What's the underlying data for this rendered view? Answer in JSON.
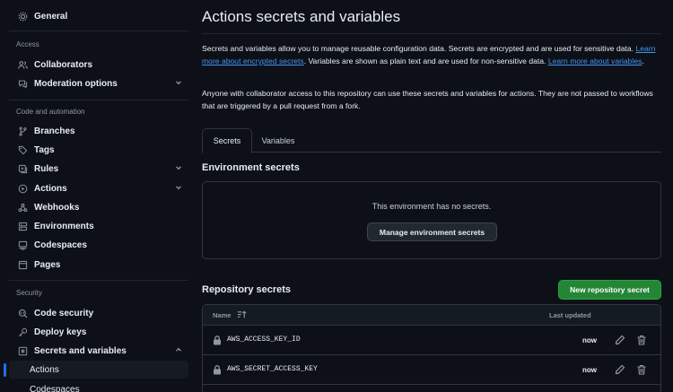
{
  "sidebar": {
    "general": "General",
    "sections": {
      "access": "Access",
      "code_automation": "Code and automation",
      "security": "Security"
    },
    "items": {
      "collaborators": "Collaborators",
      "moderation": "Moderation options",
      "branches": "Branches",
      "tags": "Tags",
      "rules": "Rules",
      "actions": "Actions",
      "webhooks": "Webhooks",
      "environments": "Environments",
      "codespaces": "Codespaces",
      "pages": "Pages",
      "code_security": "Code security",
      "deploy_keys": "Deploy keys",
      "secrets_variables": "Secrets and variables",
      "sub_actions": "Actions",
      "sub_codespaces": "Codespaces"
    }
  },
  "main": {
    "title": "Actions secrets and variables",
    "intro": {
      "p1_a": "Secrets and variables allow you to manage reusable configuration data. Secrets are encrypted and are used for sensitive data. ",
      "link1": "Learn more about encrypted secrets",
      "p1_b": ". Variables are shown as plain text and are used for non-sensitive data. ",
      "link2": "Learn more about variables",
      "p1_c": ".",
      "p2": "Anyone with collaborator access to this repository can use these secrets and variables for actions. They are not passed to workflows that are triggered by a pull request from a fork."
    },
    "tabs": {
      "secrets": "Secrets",
      "variables": "Variables"
    },
    "environment": {
      "heading": "Environment secrets",
      "empty": "This environment has no secrets.",
      "manage_button": "Manage environment secrets"
    },
    "repository": {
      "heading": "Repository secrets",
      "new_button": "New repository secret",
      "col_name": "Name",
      "col_updated": "Last updated",
      "rows": [
        {
          "name": "AWS_ACCESS_KEY_ID",
          "updated": "now"
        },
        {
          "name": "AWS_SECRET_ACCESS_KEY",
          "updated": "now"
        }
      ]
    }
  },
  "colors": {
    "background": "#0d1117",
    "border": "#30363d",
    "link": "#4493f8",
    "primary_button": "#238636",
    "active_indicator": "#1f6feb"
  }
}
